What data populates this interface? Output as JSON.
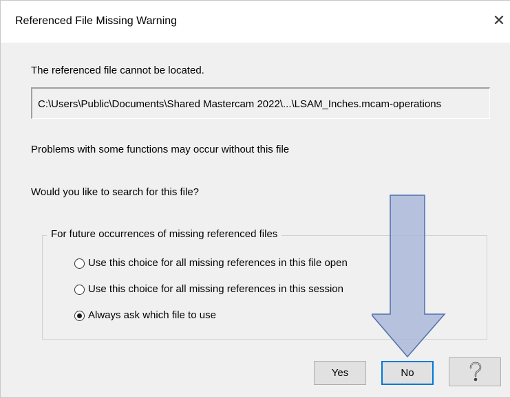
{
  "dialog": {
    "title": "Referenced File Missing Warning",
    "close_glyph": "✕"
  },
  "message": {
    "not_located": "The referenced file cannot be located.",
    "path": "C:\\Users\\Public\\Documents\\Shared Mastercam 2022\\...\\LSAM_Inches.mcam-operations",
    "problems": "Problems with some functions may occur without this file",
    "question": "Would you like to search for this file?"
  },
  "options_group": {
    "legend": "For future occurrences of missing referenced files",
    "options": [
      {
        "label": "Use this choice for all missing references in this file open",
        "selected": false
      },
      {
        "label": "Use this choice for all missing references in this session",
        "selected": false
      },
      {
        "label": "Always ask which file to use",
        "selected": true
      }
    ]
  },
  "buttons": {
    "yes": "Yes",
    "no": "No",
    "help_glyph": "?"
  },
  "colors": {
    "arrow_fill": "#aab9d9",
    "arrow_stroke": "#4f6fae",
    "default_button_border": "#0078d7"
  }
}
